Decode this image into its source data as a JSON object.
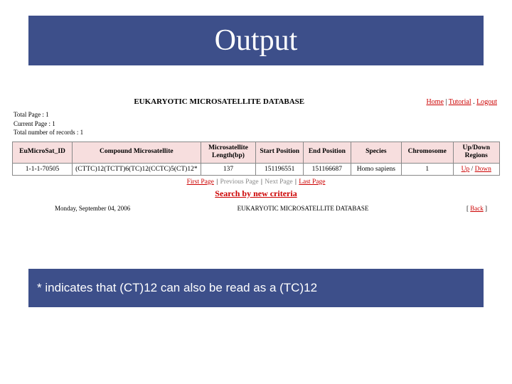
{
  "slide": {
    "title": "Output",
    "footnote": "* indicates that (CT)12 can also be read as a (TC)12"
  },
  "db": {
    "title": "EUKARYOTIC MICROSATELLITE DATABASE",
    "nav": {
      "home": "Home",
      "tutorial": "Tutorial",
      "logout": "Logout"
    },
    "meta": {
      "total_pages": "Total Page : 1",
      "current_page": "Current Page : 1",
      "total_records": "Total number of records : 1"
    },
    "columns": {
      "id": "EuMicroSat_ID",
      "motif": "Compound Microsatellite",
      "len": "Microsatellite Length(bp)",
      "start": "Start Position",
      "end": "End Position",
      "species": "Species",
      "chrom": "Chromosome",
      "updown": "Up/Down Regions"
    },
    "rows": [
      {
        "id": "1-1-1-70505",
        "motif": "(CTTC)12(TCTT)6(TC)12(CCTC)5(CT)12*",
        "len": "137",
        "start": "151196551",
        "end": "151166687",
        "species": "Homo sapiens",
        "chrom": "1",
        "up": "Up",
        "down": "Down"
      }
    ],
    "pager": {
      "first": "First Page",
      "prev": "Previous Page",
      "next": "Next Page",
      "last": "Last Page"
    },
    "search_new": "Search by new criteria",
    "footer": {
      "date": "Monday, September 04, 2006",
      "name": "EUKARYOTIC MICROSATELLITE DATABASE",
      "back": "Back"
    }
  }
}
